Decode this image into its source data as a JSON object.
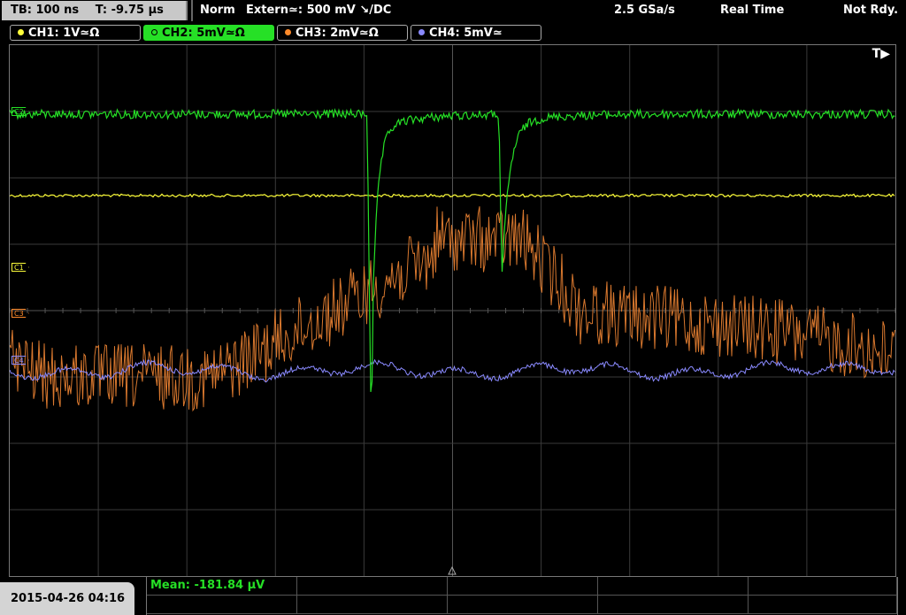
{
  "status": {
    "timebase": "TB: 100 ns",
    "trigger_time": "T: -9.75 µs",
    "mode": "Norm",
    "trigger_source": "Extern≃: 500 mV ↘/DC",
    "sample_rate": "2.5 GSa/s",
    "acq_mode": "Real Time",
    "state": "Not Rdy."
  },
  "channels": [
    {
      "label": "CH1: 1V≃Ω",
      "color": "#ffff3a",
      "active": false
    },
    {
      "label": "CH2: 5mV≃Ω",
      "color": "#26e026",
      "active": true
    },
    {
      "label": "CH3: 2mV≃Ω",
      "color": "#ff8a2a",
      "active": false
    },
    {
      "label": "CH4: 5mV≃",
      "color": "#8a8aff",
      "active": false
    }
  ],
  "markers": {
    "c2": "C2",
    "c1": "C1",
    "c3": "C3",
    "c4": "C4"
  },
  "trigger_flag": "T▶",
  "measurement": {
    "mean": "Mean: -181.84 µV"
  },
  "timestamp": "2015-04-26 04:16",
  "colors": {
    "ch1": "#ffff3a",
    "ch2": "#26e026",
    "ch3": "#d9782e",
    "ch4": "#8a8aff",
    "grid": "#3a3a3a"
  }
}
